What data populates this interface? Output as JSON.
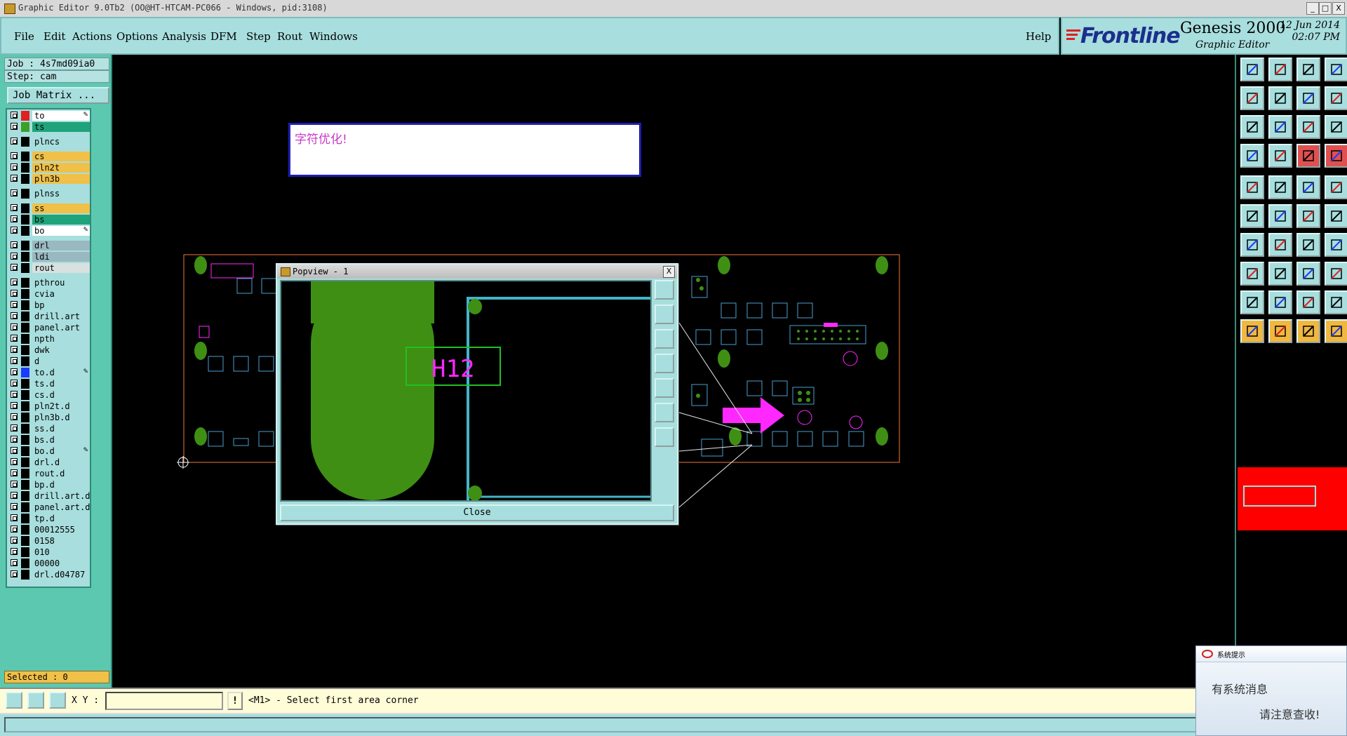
{
  "window": {
    "title": "Graphic Editor 9.0Tb2 (OO@HT-HTCAM-PC066 - Windows, pid:3108)",
    "min_label": "_",
    "max_label": "□",
    "close_label": "X"
  },
  "menu": {
    "items": [
      "File",
      "Edit",
      "Actions",
      "Options",
      "Analysis",
      "DFM",
      "Step",
      "Rout",
      "Windows"
    ],
    "help": "Help"
  },
  "brand": {
    "logo": "Frontline",
    "product": "Genesis 2000",
    "subtitle": "Graphic Editor",
    "date": "12 Jun 2014",
    "time": "02:07 PM"
  },
  "job": {
    "job_label": "Job : 4s7md09ia0",
    "step_label": "Step: cam",
    "matrix_button": "Job Matrix ..."
  },
  "layers": [
    {
      "name": "to",
      "bg": "#ffffff",
      "swatch": "#e02020",
      "pen": true,
      "gap": false
    },
    {
      "name": "ts",
      "bg": "#1ea37a",
      "swatch": "#3aa02a",
      "pen": false,
      "gap": false
    },
    {
      "name": "plncs",
      "bg": "#a8dede",
      "swatch": "#000000",
      "pen": false,
      "gap": true
    },
    {
      "name": "cs",
      "bg": "#f0c048",
      "swatch": "#000000",
      "pen": false,
      "gap": true
    },
    {
      "name": "pln2t",
      "bg": "#f0c048",
      "swatch": "#000000",
      "pen": false,
      "gap": false
    },
    {
      "name": "pln3b",
      "bg": "#f0c048",
      "swatch": "#000000",
      "pen": false,
      "gap": false
    },
    {
      "name": "plnss",
      "bg": "#a8dede",
      "swatch": "#000000",
      "pen": false,
      "gap": true
    },
    {
      "name": "ss",
      "bg": "#f0c048",
      "swatch": "#000000",
      "pen": false,
      "gap": true
    },
    {
      "name": "bs",
      "bg": "#1ea37a",
      "swatch": "#000000",
      "pen": false,
      "gap": false
    },
    {
      "name": "bo",
      "bg": "#ffffff",
      "swatch": "#000000",
      "pen": true,
      "gap": false
    },
    {
      "name": "drl",
      "bg": "#9ab8c0",
      "swatch": "#000000",
      "pen": false,
      "gap": true
    },
    {
      "name": "ldi",
      "bg": "#9ab8c0",
      "swatch": "#000000",
      "pen": false,
      "gap": false
    },
    {
      "name": "rout",
      "bg": "#d8e0e0",
      "swatch": "#000000",
      "pen": false,
      "gap": false
    },
    {
      "name": "pthrou",
      "bg": "#a8dede",
      "swatch": "#000000",
      "pen": false,
      "gap": true
    },
    {
      "name": "cvia",
      "bg": "#a8dede",
      "swatch": "#000000",
      "pen": false,
      "gap": false
    },
    {
      "name": "bp",
      "bg": "#a8dede",
      "swatch": "#000000",
      "pen": false,
      "gap": false
    },
    {
      "name": "drill.art",
      "bg": "#a8dede",
      "swatch": "#000000",
      "pen": false,
      "gap": false
    },
    {
      "name": "panel.art",
      "bg": "#a8dede",
      "swatch": "#000000",
      "pen": false,
      "gap": false
    },
    {
      "name": "npth",
      "bg": "#a8dede",
      "swatch": "#000000",
      "pen": false,
      "gap": false
    },
    {
      "name": "dwk",
      "bg": "#a8dede",
      "swatch": "#000000",
      "pen": false,
      "gap": false
    },
    {
      "name": "d",
      "bg": "#a8dede",
      "swatch": "#000000",
      "pen": false,
      "gap": false
    },
    {
      "name": "to.d",
      "bg": "#a8dede",
      "swatch": "#1a3cff",
      "pen": true,
      "gap": false
    },
    {
      "name": "ts.d",
      "bg": "#a8dede",
      "swatch": "#000000",
      "pen": false,
      "gap": false
    },
    {
      "name": "cs.d",
      "bg": "#a8dede",
      "swatch": "#000000",
      "pen": false,
      "gap": false
    },
    {
      "name": "pln2t.d",
      "bg": "#a8dede",
      "swatch": "#000000",
      "pen": false,
      "gap": false
    },
    {
      "name": "pln3b.d",
      "bg": "#a8dede",
      "swatch": "#000000",
      "pen": false,
      "gap": false
    },
    {
      "name": "ss.d",
      "bg": "#a8dede",
      "swatch": "#000000",
      "pen": false,
      "gap": false
    },
    {
      "name": "bs.d",
      "bg": "#a8dede",
      "swatch": "#000000",
      "pen": false,
      "gap": false
    },
    {
      "name": "bo.d",
      "bg": "#a8dede",
      "swatch": "#000000",
      "pen": true,
      "gap": false
    },
    {
      "name": "drl.d",
      "bg": "#a8dede",
      "swatch": "#000000",
      "pen": false,
      "gap": false
    },
    {
      "name": "rout.d",
      "bg": "#a8dede",
      "swatch": "#000000",
      "pen": false,
      "gap": false
    },
    {
      "name": "bp.d",
      "bg": "#a8dede",
      "swatch": "#000000",
      "pen": false,
      "gap": false
    },
    {
      "name": "drill.art.d",
      "bg": "#a8dede",
      "swatch": "#000000",
      "pen": false,
      "gap": false
    },
    {
      "name": "panel.art.d",
      "bg": "#a8dede",
      "swatch": "#000000",
      "pen": false,
      "gap": false
    },
    {
      "name": "tp.d",
      "bg": "#a8dede",
      "swatch": "#000000",
      "pen": false,
      "gap": false
    },
    {
      "name": "00012555",
      "bg": "#a8dede",
      "swatch": "#000000",
      "pen": false,
      "gap": false
    },
    {
      "name": "0158",
      "bg": "#a8dede",
      "swatch": "#000000",
      "pen": false,
      "gap": false
    },
    {
      "name": "010",
      "bg": "#a8dede",
      "swatch": "#000000",
      "pen": false,
      "gap": false
    },
    {
      "name": "00000",
      "bg": "#a8dede",
      "swatch": "#000000",
      "pen": false,
      "gap": false
    },
    {
      "name": "drl.d04787",
      "bg": "#a8dede",
      "swatch": "#000000",
      "pen": false,
      "gap": false
    }
  ],
  "selected_label": "Selected : 0",
  "message_box": {
    "text": "字符优化!"
  },
  "popview": {
    "title": "Popview - 1",
    "pad_label": "H12",
    "close_button": "Close",
    "close_x": "X"
  },
  "command": {
    "xy_label": "X Y :",
    "xy_value": "",
    "bang_label": "!",
    "prompt": "<M1> - Select first area corner"
  },
  "notification": {
    "title": "系统提示",
    "line1": "有系统消息",
    "line2": "请注意查收!"
  },
  "colors": {
    "panel": "#a8dede",
    "canvas": "#000000",
    "pad_green": "#3f8f14",
    "outline_cyan": "#42b4c8",
    "annotation_magenta": "#ff28ff",
    "board_outline": "#f07838"
  },
  "right_toolbar_icons": [
    "open-step-icon",
    "save-icon",
    "home-icon",
    "window-layout-icon",
    "pan-left-icon",
    "pan-right-icon",
    "zoom-back-icon",
    "snap-icon",
    "zoom-fit-icon",
    "zoom-center-icon",
    "ratio-1-2-icon",
    "query-icon",
    "rotate-view-icon",
    "pad-icon",
    "net-red-icon",
    "net-blue-icon",
    "record-icon",
    "draw-line-icon",
    "ruler-icon",
    "circle-icon",
    "connect-nodes-icon",
    "cross-icon",
    "node-link-icon",
    "node-link-alt-icon",
    "slope-line-icon",
    "blue-line-icon",
    "arc-icon",
    "route-icon",
    "pad-marker-icon",
    "measure-red-icon",
    "measure-box-icon",
    "network-icon",
    "triangle-red-icon",
    "text-a-icon",
    "text-a-alt-icon",
    "text-a-blue-icon",
    "select-pointer-icon",
    "select-pointer-alt-icon",
    "select-pointer-red-icon",
    "select-route-icon"
  ]
}
